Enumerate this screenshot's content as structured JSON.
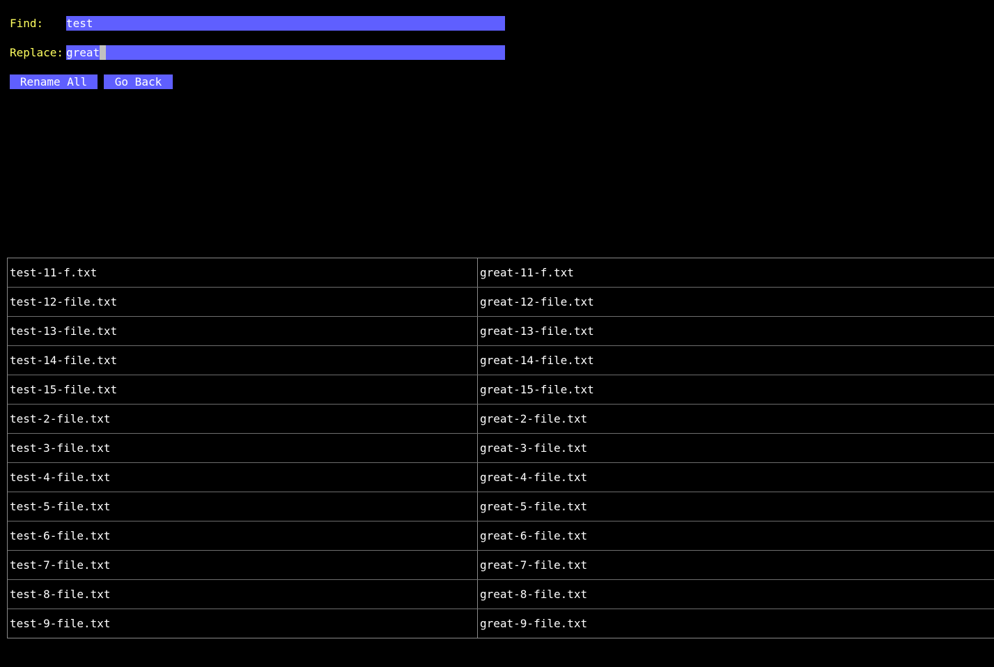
{
  "form": {
    "find_label": "Find:",
    "find_value": "test",
    "replace_label": "Replace:",
    "replace_value": "great"
  },
  "buttons": {
    "rename_all": "Rename All",
    "go_back": "Go Back"
  },
  "colors": {
    "background": "#000000",
    "label": "#ffff5f",
    "field": "#5f5fff",
    "text": "#ffffff",
    "cursor": "#c0c0c0"
  },
  "preview_rows": [
    {
      "original": "test-11-f.txt",
      "renamed": "great-11-f.txt"
    },
    {
      "original": "test-12-file.txt",
      "renamed": "great-12-file.txt"
    },
    {
      "original": "test-13-file.txt",
      "renamed": "great-13-file.txt"
    },
    {
      "original": "test-14-file.txt",
      "renamed": "great-14-file.txt"
    },
    {
      "original": "test-15-file.txt",
      "renamed": "great-15-file.txt"
    },
    {
      "original": "test-2-file.txt",
      "renamed": "great-2-file.txt"
    },
    {
      "original": "test-3-file.txt",
      "renamed": "great-3-file.txt"
    },
    {
      "original": "test-4-file.txt",
      "renamed": "great-4-file.txt"
    },
    {
      "original": "test-5-file.txt",
      "renamed": "great-5-file.txt"
    },
    {
      "original": "test-6-file.txt",
      "renamed": "great-6-file.txt"
    },
    {
      "original": "test-7-file.txt",
      "renamed": "great-7-file.txt"
    },
    {
      "original": "test-8-file.txt",
      "renamed": "great-8-file.txt"
    },
    {
      "original": "test-9-file.txt",
      "renamed": "great-9-file.txt"
    }
  ]
}
